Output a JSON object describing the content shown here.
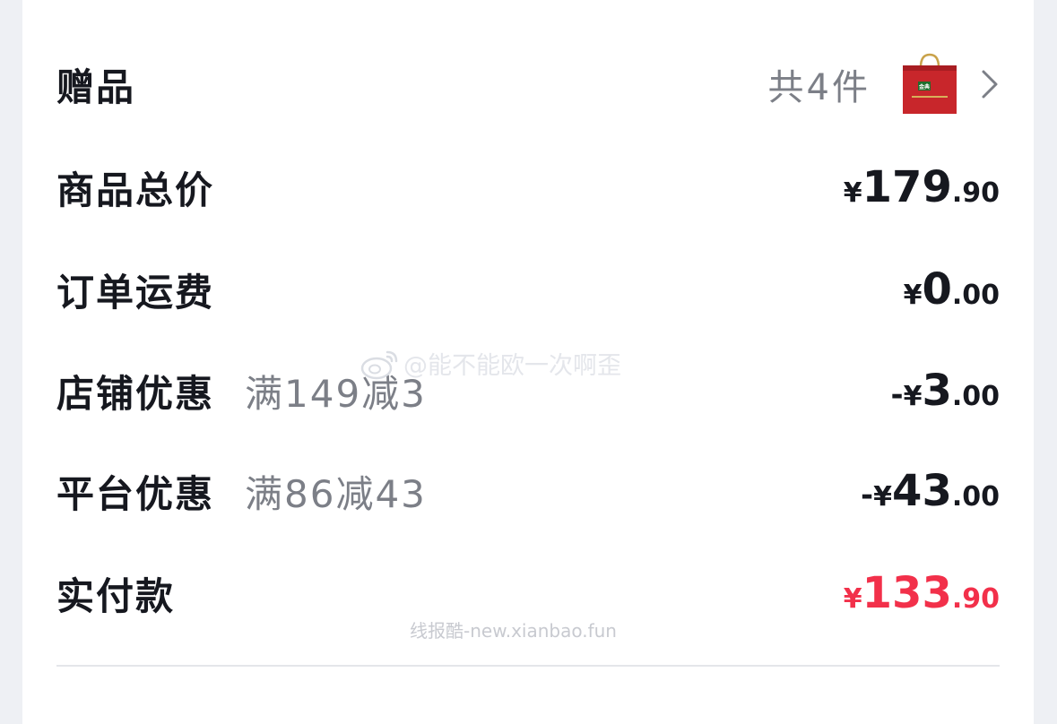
{
  "gift": {
    "label": "赠品",
    "count_text": "共4件",
    "thumb_text": "金典"
  },
  "goods_total": {
    "label": "商品总价",
    "currency": "¥",
    "integer": "179",
    "decimal": ".90"
  },
  "shipping": {
    "label": "订单运费",
    "currency": "¥",
    "integer": "0",
    "decimal": ".00"
  },
  "store_discount": {
    "label": "店铺优惠",
    "rule": "满149减3",
    "sign": "-",
    "currency": "¥",
    "integer": "3",
    "decimal": ".00"
  },
  "platform_discount": {
    "label": "平台优惠",
    "rule": "满86减43",
    "sign": "-",
    "currency": "¥",
    "integer": "43",
    "decimal": ".00"
  },
  "actual_payment": {
    "label": "实付款",
    "currency": "¥",
    "integer": "133",
    "decimal": ".90"
  },
  "watermarks": {
    "weibo": "@能不能欧一次啊歪",
    "site": "线报酷-new.xianbao.fun"
  },
  "colors": {
    "text_primary": "#16181f",
    "text_secondary": "#7c7f87",
    "price_red": "#f2304a",
    "bag_red": "#c8262b",
    "bag_label_green": "#1f6e2c"
  },
  "icons": {
    "gift_arrow": "chevron-right-icon",
    "weibo_logo": "weibo-icon"
  }
}
